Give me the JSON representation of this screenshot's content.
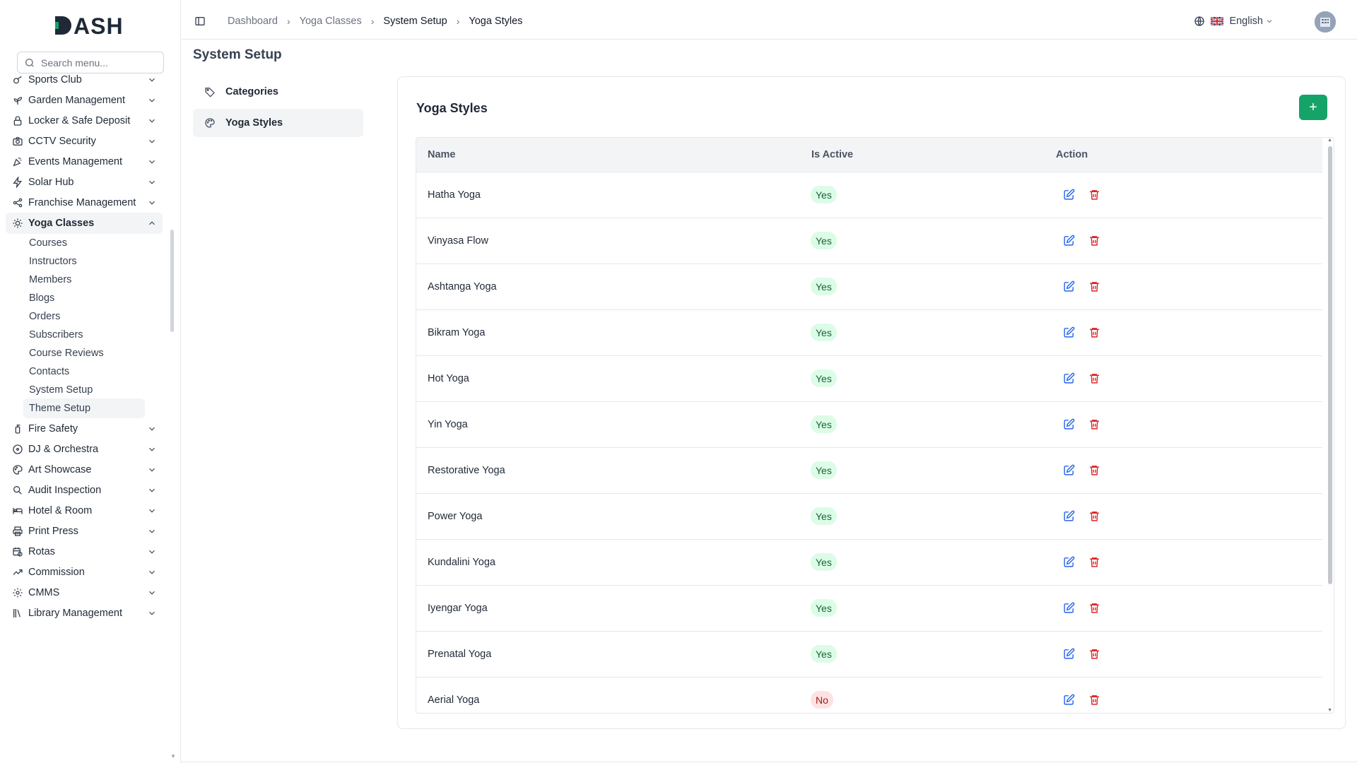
{
  "app": {
    "logo_text": "DASH"
  },
  "search": {
    "placeholder": "Search menu..."
  },
  "sidebar": {
    "items": [
      {
        "label": "Sports Club",
        "icon": "whistle-icon"
      },
      {
        "label": "Garden Management",
        "icon": "plant-icon"
      },
      {
        "label": "Locker & Safe Deposit",
        "icon": "lock-icon"
      },
      {
        "label": "CCTV Security",
        "icon": "camera-icon"
      },
      {
        "label": "Events Management",
        "icon": "party-icon"
      },
      {
        "label": "Solar Hub",
        "icon": "bolt-icon"
      },
      {
        "label": "Franchise Management",
        "icon": "share-icon"
      },
      {
        "label": "Yoga Classes",
        "icon": "sun-icon"
      },
      {
        "label": "Fire Safety",
        "icon": "extinguisher-icon"
      },
      {
        "label": "DJ & Orchestra",
        "icon": "disc-icon"
      },
      {
        "label": "Art Showcase",
        "icon": "palette-icon"
      },
      {
        "label": "Audit Inspection",
        "icon": "search-check-icon"
      },
      {
        "label": "Hotel & Room",
        "icon": "bed-icon"
      },
      {
        "label": "Print Press",
        "icon": "printer-icon"
      },
      {
        "label": "Rotas",
        "icon": "calendar-clock-icon"
      },
      {
        "label": "Commission",
        "icon": "trending-up-icon"
      },
      {
        "label": "CMMS",
        "icon": "gears-icon"
      },
      {
        "label": "Library Management",
        "icon": "library-icon"
      }
    ],
    "sub_items": [
      "Courses",
      "Instructors",
      "Members",
      "Blogs",
      "Orders",
      "Subscribers",
      "Course Reviews",
      "Contacts",
      "System Setup",
      "Theme Setup"
    ]
  },
  "header": {
    "breadcrumbs": [
      "Dashboard",
      "Yoga Classes",
      "System Setup",
      "Yoga Styles"
    ],
    "language": "English"
  },
  "page": {
    "title": "System Setup",
    "sub_nav": [
      "Categories",
      "Yoga Styles"
    ]
  },
  "card": {
    "title": "Yoga Styles",
    "add_label": "+",
    "columns": [
      "Name",
      "Is Active",
      "Action"
    ],
    "rows": [
      {
        "name": "Hatha Yoga",
        "active": "Yes"
      },
      {
        "name": "Vinyasa Flow",
        "active": "Yes"
      },
      {
        "name": "Ashtanga Yoga",
        "active": "Yes"
      },
      {
        "name": "Bikram Yoga",
        "active": "Yes"
      },
      {
        "name": "Hot Yoga",
        "active": "Yes"
      },
      {
        "name": "Yin Yoga",
        "active": "Yes"
      },
      {
        "name": "Restorative Yoga",
        "active": "Yes"
      },
      {
        "name": "Power Yoga",
        "active": "Yes"
      },
      {
        "name": "Kundalini Yoga",
        "active": "Yes"
      },
      {
        "name": "Iyengar Yoga",
        "active": "Yes"
      },
      {
        "name": "Prenatal Yoga",
        "active": "Yes"
      },
      {
        "name": "Aerial Yoga",
        "active": "No"
      }
    ]
  },
  "colors": {
    "accent": "#16a36a",
    "edit": "#2563eb",
    "delete": "#dc2626"
  }
}
